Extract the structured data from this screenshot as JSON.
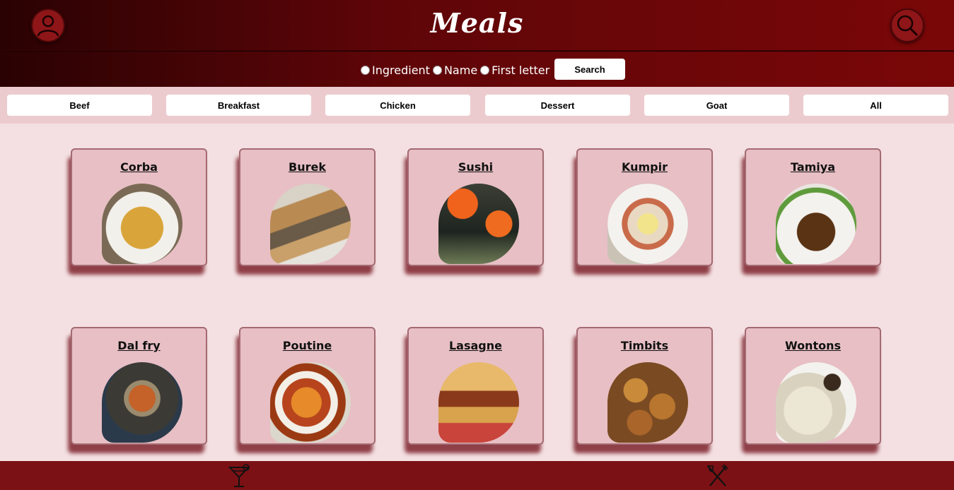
{
  "header": {
    "title": "Meals"
  },
  "search": {
    "options": [
      "Ingredient",
      "Name",
      "First letter"
    ],
    "button_label": "Search"
  },
  "categories": [
    "Beef",
    "Breakfast",
    "Chicken",
    "Dessert",
    "Goat",
    "All"
  ],
  "meals": [
    {
      "name": "Corba"
    },
    {
      "name": "Burek"
    },
    {
      "name": "Sushi"
    },
    {
      "name": "Kumpir"
    },
    {
      "name": "Tamiya"
    },
    {
      "name": "Dal fry"
    },
    {
      "name": "Poutine"
    },
    {
      "name": "Lasagne"
    },
    {
      "name": "Timbits"
    },
    {
      "name": "Wontons"
    }
  ],
  "footer": {
    "icons": [
      "cocktail-icon",
      "fork-knife-icon"
    ]
  },
  "colors": {
    "header_dark": "#2a0203",
    "header_red": "#7a0708",
    "page_bg": "#f4e0e2",
    "card_bg": "#e7bfc4",
    "footer_bg": "#7b1115"
  }
}
